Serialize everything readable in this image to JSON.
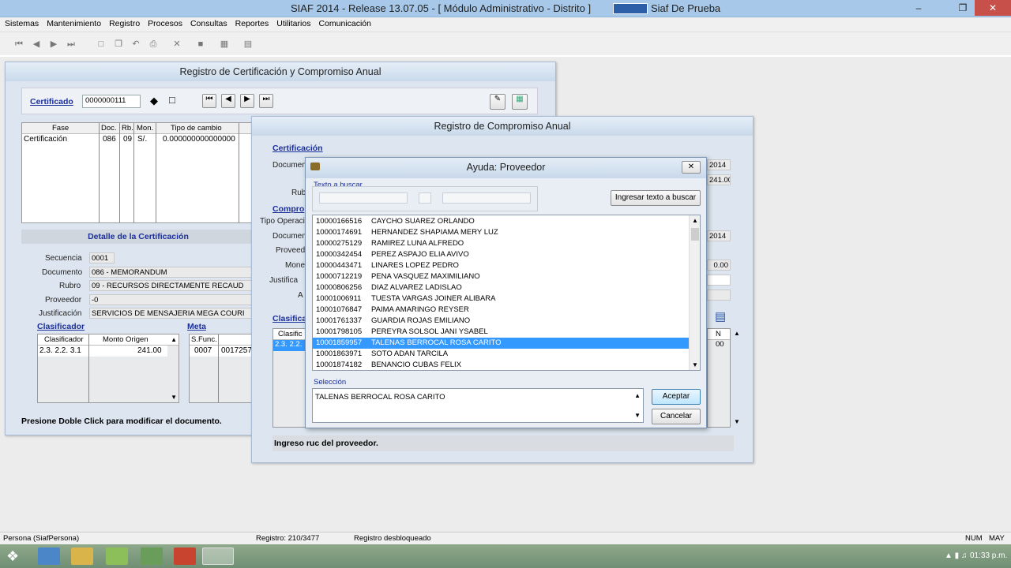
{
  "window": {
    "title": "SIAF 2014 - Release 13.07.05 - [ Módulo Administrativo - Distrito ]",
    "env": "Siaf De Prueba"
  },
  "menu": [
    "Sistemas",
    "Mantenimiento",
    "Registro",
    "Procesos",
    "Consultas",
    "Reportes",
    "Utilitarios",
    "Comunicación"
  ],
  "cert_win": {
    "title": "Registro de Certificación y Compromiso Anual",
    "cert_label": "Certificado",
    "cert_value": "0000000111",
    "fase_headers": [
      "Fase",
      "Doc.",
      "Rb.",
      "Mon.",
      "Tipo de cambio"
    ],
    "fase_row": [
      "Certificación",
      "086",
      "09",
      "S/.",
      "0.000000000000000"
    ],
    "detalle_title": "Detalle de la Certificación",
    "secuencia_label": "Secuencia",
    "secuencia": "0001",
    "documento_label": "Documento",
    "documento": "086 - MEMORANDUM",
    "rubro_label": "Rubro",
    "rubro": "09 - RECURSOS DIRECTAMENTE RECAUD",
    "proveedor_label": "Proveedor",
    "proveedor": "-0",
    "justificacion_label": "Justificación",
    "justificacion": "SERVICIOS DE MENSAJERIA MEGA COURI",
    "clasificador_link": "Clasificador",
    "meta_link": "Meta",
    "clas_headers": [
      "Clasificador",
      "Monto Origen"
    ],
    "clas_row": [
      "2.3. 2.2. 3.1",
      "241.00"
    ],
    "meta_headers": [
      "S.Func."
    ],
    "meta_row": [
      "0007",
      "0017257"
    ],
    "footer": "Presione Doble Click para modificar el documento."
  },
  "comp_win": {
    "title": "Registro de Compromiso Anual",
    "cert_link": "Certificación",
    "comp_link": "Compro",
    "clas_link": "Clasifica",
    "documento_label": "Documen",
    "rubro_label": "Rub",
    "tipo_op_label": "Tipo Operaci",
    "documento2_label": "Documen",
    "proveedor_label": "Proveed",
    "moneda_label": "Mone",
    "justif_label": "Justifica",
    "a_label": "A",
    "r1": "2014",
    "r2": "241.00",
    "r3": "2014",
    "r4": "0.00",
    "clas_head": "Clasific",
    "clas_val": "2.3. 2.2.",
    "side_head": "N",
    "side_val": "00",
    "footer": "Ingreso ruc del proveedor."
  },
  "dialog": {
    "title": "Ayuda: Proveedor",
    "search_label": "Texto a buscar",
    "search_btn": "Ingresar texto a buscar",
    "rows": [
      {
        "ruc": "10000166516",
        "name": "CAYCHO SUAREZ ORLANDO"
      },
      {
        "ruc": "10000174691",
        "name": "HERNANDEZ SHAPIAMA MERY LUZ"
      },
      {
        "ruc": "10000275129",
        "name": "RAMIREZ LUNA ALFREDO"
      },
      {
        "ruc": "10000342454",
        "name": "PEREZ ASPAJO ELIA AVIVO"
      },
      {
        "ruc": "10000443471",
        "name": "LINARES LOPEZ PEDRO"
      },
      {
        "ruc": "10000712219",
        "name": "PENA VASQUEZ MAXIMILIANO"
      },
      {
        "ruc": "10000806256",
        "name": "DIAZ ALVAREZ LADISLAO"
      },
      {
        "ruc": "10001006911",
        "name": "TUESTA VARGAS JOINER ALIBARA"
      },
      {
        "ruc": "10001076847",
        "name": "PAIMA AMARINGO REYSER"
      },
      {
        "ruc": "10001761337",
        "name": "GUARDIA ROJAS EMILIANO"
      },
      {
        "ruc": "10001798105",
        "name": "PEREYRA SOLSOL JANI YSABEL"
      },
      {
        "ruc": "10001859957",
        "name": "TALENAS BERROCAL ROSA CARITO"
      },
      {
        "ruc": "10001863971",
        "name": "SOTO ADAN TARCILA"
      },
      {
        "ruc": "10001874182",
        "name": "BENANCIO CUBAS FELIX"
      }
    ],
    "selected_index": 11,
    "selection_label": "Selección",
    "selection_value": "TALENAS BERROCAL ROSA CARITO",
    "accept": "Aceptar",
    "cancel": "Cancelar"
  },
  "status": {
    "persona": "Persona (SiafPersona)",
    "registro": "Registro: 210/3477",
    "estado": "Registro desbloqueado",
    "num": "NUM",
    "may": "MAY"
  },
  "clock": "01:33 p.m."
}
